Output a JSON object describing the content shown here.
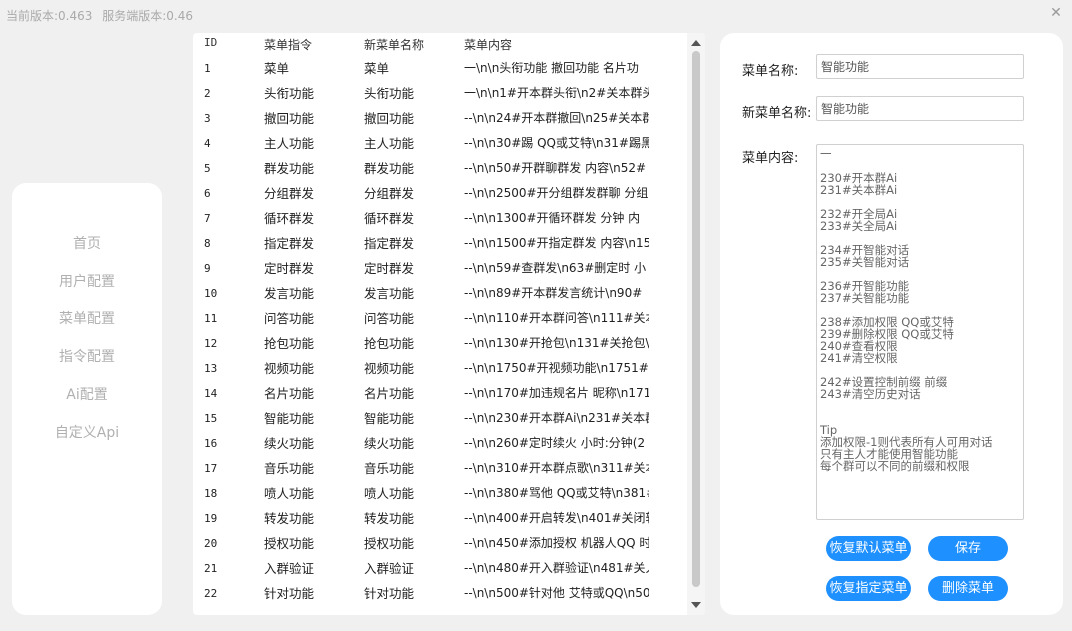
{
  "titlebar": {
    "current_version": "当前版本:0.463",
    "server_version": "服务端版本:0.46",
    "close_glyph": "✕"
  },
  "sidebar": {
    "items": [
      {
        "label": "首页"
      },
      {
        "label": "用户配置"
      },
      {
        "label": "菜单配置"
      },
      {
        "label": "指令配置"
      },
      {
        "label": "Ai配置"
      },
      {
        "label": "自定义Api"
      }
    ]
  },
  "table": {
    "headers": {
      "id": "ID",
      "cmd": "菜单指令",
      "name": "新菜单名称",
      "content": "菜单内容"
    },
    "rows": [
      {
        "id": "1",
        "cmd": "菜单",
        "name": "菜单",
        "content": "一\\n\\n头衔功能 撤回功能 名片功"
      },
      {
        "id": "2",
        "cmd": "头衔功能",
        "name": "头衔功能",
        "content": "一\\n\\n1#开本群头衔\\n2#关本群头"
      },
      {
        "id": "3",
        "cmd": "撤回功能",
        "name": "撤回功能",
        "content": "--\\n\\n24#开本群撤回\\n25#关本群"
      },
      {
        "id": "4",
        "cmd": "主人功能",
        "name": "主人功能",
        "content": "--\\n\\n30#踢 QQ或艾特\\n31#踢黑"
      },
      {
        "id": "5",
        "cmd": "群发功能",
        "name": "群发功能",
        "content": "--\\n\\n50#开群聊群发  内容\\n52#"
      },
      {
        "id": "6",
        "cmd": "分组群发",
        "name": "分组群发",
        "content": "--\\n\\n2500#开分组群发群聊 分组"
      },
      {
        "id": "7",
        "cmd": "循环群发",
        "name": "循环群发",
        "content": "--\\n\\n1300#开循环群发 分钟 内"
      },
      {
        "id": "8",
        "cmd": "指定群发",
        "name": "指定群发",
        "content": "--\\n\\n1500#开指定群发  内容\\n15"
      },
      {
        "id": "9",
        "cmd": "定时群发",
        "name": "定时群发",
        "content": "--\\n\\n59#查群发\\n63#删定时 小"
      },
      {
        "id": "10",
        "cmd": "发言功能",
        "name": "发言功能",
        "content": "--\\n\\n89#开本群发言统计\\n90#"
      },
      {
        "id": "11",
        "cmd": "问答功能",
        "name": "问答功能",
        "content": "--\\n\\n110#开本群问答\\n111#关本"
      },
      {
        "id": "12",
        "cmd": "抢包功能",
        "name": "抢包功能",
        "content": "--\\n\\n130#开抢包\\n131#关抢包\\n"
      },
      {
        "id": "13",
        "cmd": "视频功能",
        "name": "视频功能",
        "content": "--\\n\\n1750#开视频功能\\n1751#关"
      },
      {
        "id": "14",
        "cmd": "名片功能",
        "name": "名片功能",
        "content": "--\\n\\n170#加违规名片  昵称\\n171"
      },
      {
        "id": "15",
        "cmd": "智能功能",
        "name": "智能功能",
        "content": "--\\n\\n230#开本群Ai\\n231#关本群"
      },
      {
        "id": "16",
        "cmd": "续火功能",
        "name": "续火功能",
        "content": "--\\n\\n260#定时续火 小时:分钟(2"
      },
      {
        "id": "17",
        "cmd": "音乐功能",
        "name": "音乐功能",
        "content": "--\\n\\n310#开本群点歌\\n311#关本"
      },
      {
        "id": "18",
        "cmd": "喷人功能",
        "name": "喷人功能",
        "content": "--\\n\\n380#骂他 QQ或艾特\\n381#"
      },
      {
        "id": "19",
        "cmd": "转发功能",
        "name": "转发功能",
        "content": "--\\n\\n400#开启转发\\n401#关闭转"
      },
      {
        "id": "20",
        "cmd": "授权功能",
        "name": "授权功能",
        "content": "--\\n\\n450#添加授权  机器人QQ 时"
      },
      {
        "id": "21",
        "cmd": "入群验证",
        "name": "入群验证",
        "content": "--\\n\\n480#开入群验证\\n481#关入"
      },
      {
        "id": "22",
        "cmd": "针对功能",
        "name": "针对功能",
        "content": "--\\n\\n500#针对他  艾特或QQ\\n501"
      }
    ]
  },
  "form": {
    "menu_name_label": "菜单名称:",
    "menu_name_value": "智能功能",
    "new_menu_name_label": "新菜单名称:",
    "new_menu_name_value": "智能功能",
    "menu_content_label": "菜单内容:",
    "menu_content_value": "一\n\n230#开本群Ai\n231#关本群Ai\n\n232#开全局Ai\n233#关全局Ai\n\n234#开智能对话\n235#关智能对话\n\n236#开智能功能\n237#关智能功能\n\n238#添加权限 QQ或艾特\n239#删除权限 QQ或艾特\n240#查看权限\n241#清空权限\n\n242#设置控制前缀 前缀\n243#清空历史对话\n\n\nTip\n添加权限-1则代表所有人可用对话\n只有主人才能使用智能功能\n每个群可以不同的前缀和权限",
    "buttons": {
      "restore_default": "恢复默认菜单",
      "save": "保存",
      "restore_specified": "恢复指定菜单",
      "delete": "删除菜单"
    },
    "button_color": "#1e90ff"
  }
}
